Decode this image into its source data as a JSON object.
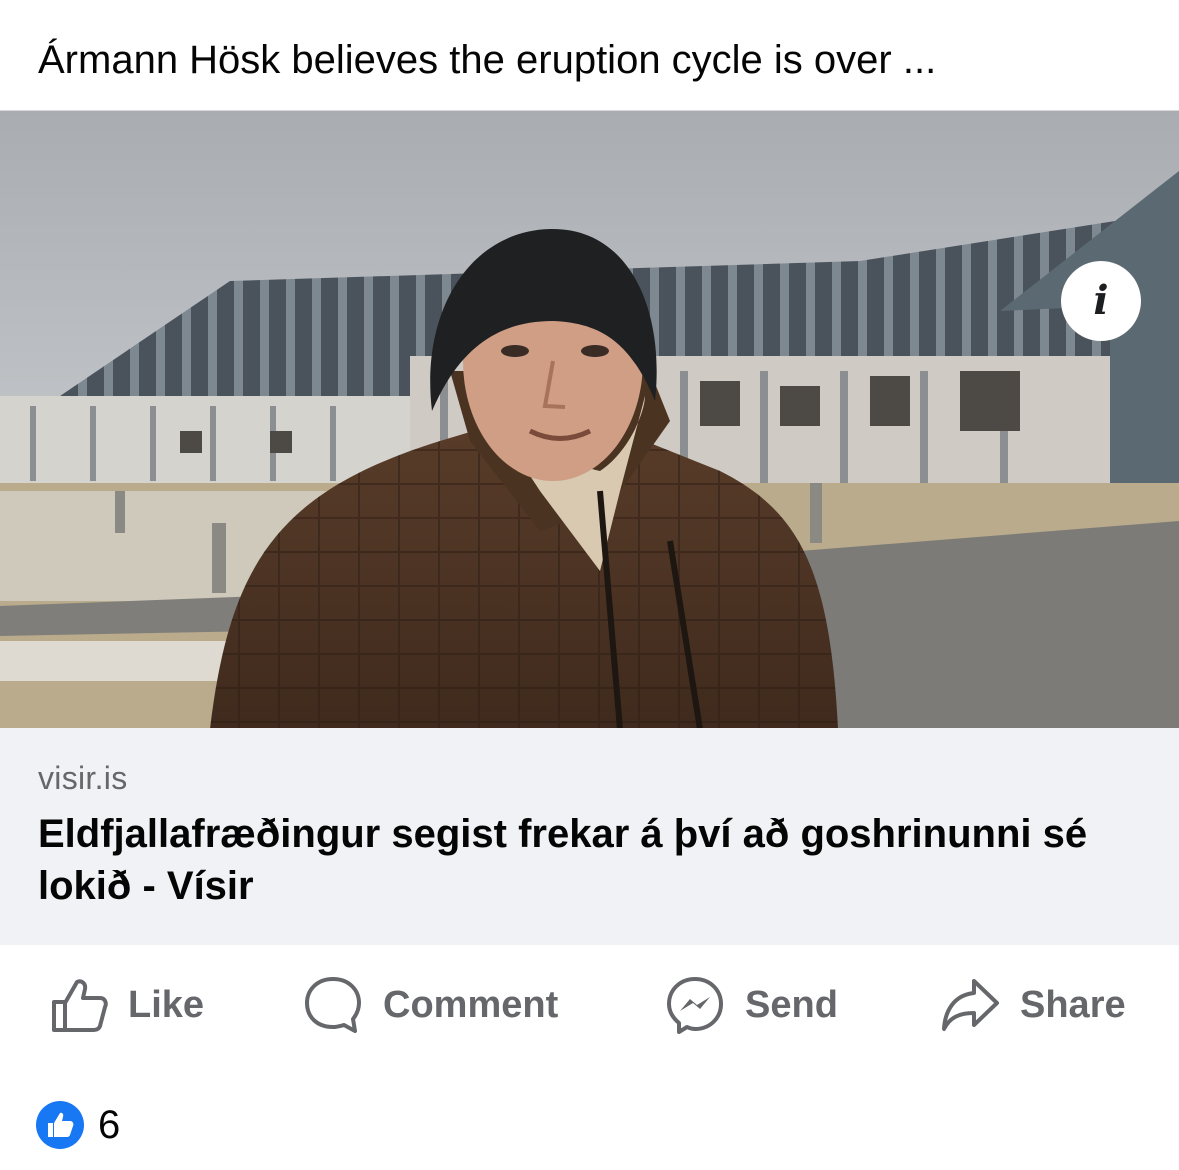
{
  "post": {
    "text": "Ármann Hösk believes the eruption cycle is over ..."
  },
  "link_preview": {
    "image_icon": "info-icon",
    "info_glyph": "i",
    "domain": "visir.is",
    "headline": "Eldfjallafræðingur segist frekar á því að goshrinunni sé lokið - Vísir"
  },
  "actions": {
    "like": {
      "label": "Like",
      "icon": "thumbs-up-outline-icon"
    },
    "comment": {
      "label": "Comment",
      "icon": "speech-bubble-icon"
    },
    "send": {
      "label": "Send",
      "icon": "messenger-icon"
    },
    "share": {
      "label": "Share",
      "icon": "share-arrow-icon"
    }
  },
  "reactions": {
    "icon": "like-reaction-icon",
    "count": "6"
  },
  "colors": {
    "reaction_blue": "#1877f2",
    "secondary_text": "#65676b",
    "card_background": "#f0f2f5"
  }
}
